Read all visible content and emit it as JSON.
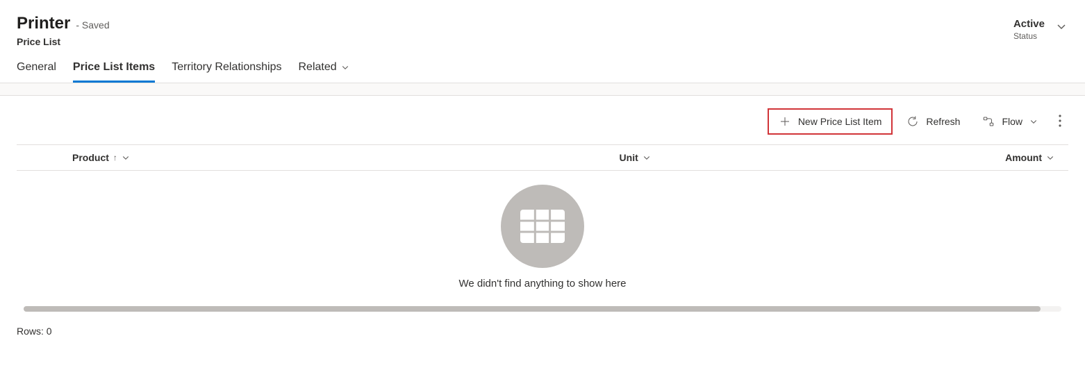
{
  "header": {
    "title": "Printer",
    "saved_label": "- Saved",
    "subtitle": "Price List",
    "status_value": "Active",
    "status_label": "Status"
  },
  "tabs": {
    "general": "General",
    "price_list_items": "Price List Items",
    "territory": "Territory Relationships",
    "related": "Related"
  },
  "toolbar": {
    "new_item": "New Price List Item",
    "refresh": "Refresh",
    "flow": "Flow"
  },
  "columns": {
    "product": "Product",
    "unit": "Unit",
    "amount": "Amount"
  },
  "empty": {
    "message": "We didn't find anything to show here"
  },
  "footer": {
    "rows_label": "Rows: 0"
  }
}
